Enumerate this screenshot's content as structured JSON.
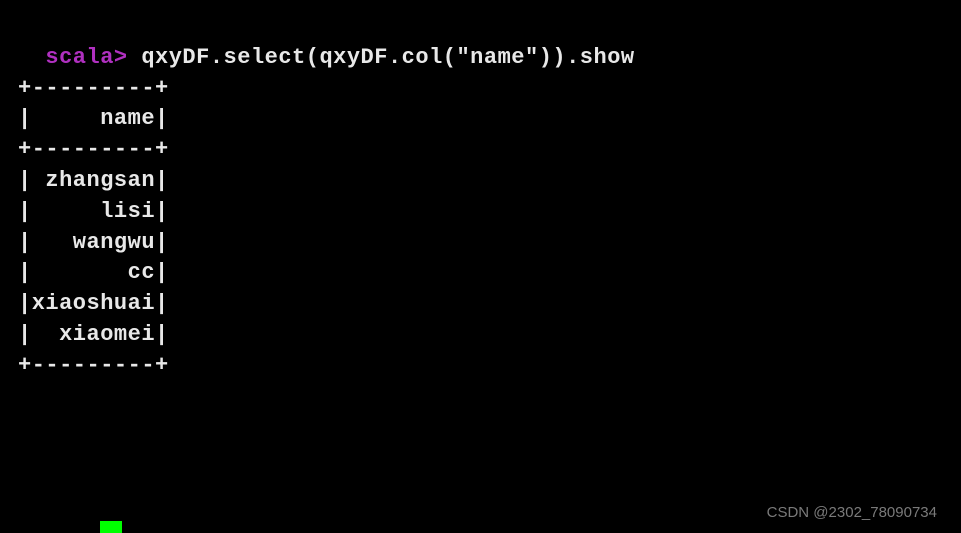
{
  "prompt": "scala>",
  "command": " qxyDF.select(qxyDF.col(\"name\")).show",
  "table": {
    "border_top": "+---------+",
    "header": "|     name|",
    "border_mid": "+---------+",
    "rows": [
      "| zhangsan|",
      "|     lisi|",
      "|   wangwu|",
      "|       cc|",
      "|xiaoshuai|",
      "|  xiaomei|"
    ],
    "border_bot": "+---------+"
  },
  "watermark": "CSDN @2302_78090734"
}
